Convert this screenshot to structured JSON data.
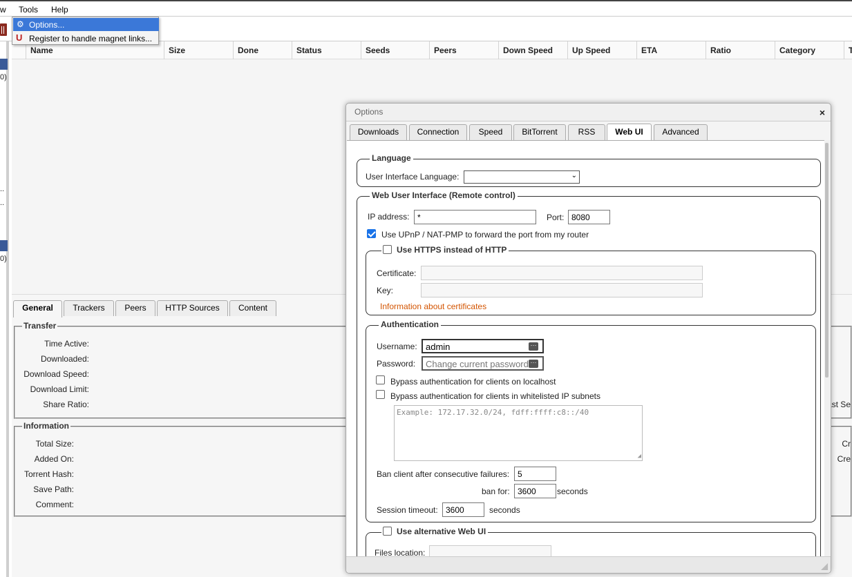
{
  "menubar": {
    "view_partial": "w",
    "tools": "Tools",
    "help": "Help"
  },
  "tools_menu": {
    "options": "Options...",
    "magnet": "Register to handle magnet links..."
  },
  "left_panel": {
    "count1": "0)",
    "dots1": "..",
    "dots2": "..",
    "count2": "0)"
  },
  "torrent_columns": [
    "Name",
    "Size",
    "Done",
    "Status",
    "Seeds",
    "Peers",
    "Down Speed",
    "Up Speed",
    "ETA",
    "Ratio",
    "Category",
    "T"
  ],
  "bottom_tabs": [
    "General",
    "Trackers",
    "Peers",
    "HTTP Sources",
    "Content"
  ],
  "transfer": {
    "legend": "Transfer",
    "time_active": "Time Active:",
    "downloaded": "Downloaded:",
    "download_speed": "Download Speed:",
    "download_limit": "Download Limit:",
    "share_ratio": "Share Ratio:",
    "last_seen_partial": "ast Se"
  },
  "information": {
    "legend": "Information",
    "total_size": "Total Size:",
    "added_on": "Added On:",
    "torrent_hash": "Torrent Hash:",
    "save_path": "Save Path:",
    "comment": "Comment:",
    "created_partial": "Cr",
    "created_on_partial": "Cre"
  },
  "dialog": {
    "title": "Options",
    "close": "×",
    "tabs": [
      "Downloads",
      "Connection",
      "Speed",
      "BitTorrent",
      "RSS",
      "Web UI",
      "Advanced"
    ],
    "active_tab": "Web UI",
    "language": {
      "legend": "Language",
      "ui_language_label": "User Interface Language:"
    },
    "webui": {
      "legend": "Web User Interface (Remote control)",
      "ip_label": "IP address:",
      "ip_value": "*",
      "port_label": "Port:",
      "port_value": "8080",
      "upnp_label": "Use UPnP / NAT-PMP to forward the port from my router",
      "upnp_checked": true
    },
    "https": {
      "legend": "Use HTTPS instead of HTTP",
      "checked": false,
      "certificate_label": "Certificate:",
      "key_label": "Key:",
      "info_link": "Information about certificates",
      "link_color": "#d35400"
    },
    "auth": {
      "legend": "Authentication",
      "username_label": "Username:",
      "username_value": "admin",
      "password_label": "Password:",
      "password_placeholder": "Change current password",
      "bypass_localhost": "Bypass authentication for clients on localhost",
      "bypass_whitelist": "Bypass authentication for clients in whitelisted IP subnets",
      "subnet_placeholder": "Example: 172.17.32.0/24, fdff:ffff:c8::/40",
      "ban_label": "Ban client after consecutive failures:",
      "ban_value": "5",
      "ban_for_label": "ban for:",
      "ban_for_value": "3600",
      "seconds1": "seconds",
      "session_label": "Session timeout:",
      "session_value": "3600",
      "seconds2": "seconds"
    },
    "altwebui": {
      "legend": "Use alternative Web UI",
      "checked": false,
      "files_label": "Files location:"
    }
  },
  "colors": {
    "selection": "#3b78d8",
    "sidebar_selected": "#3a5a98",
    "checkbox": "#1a73e8"
  }
}
